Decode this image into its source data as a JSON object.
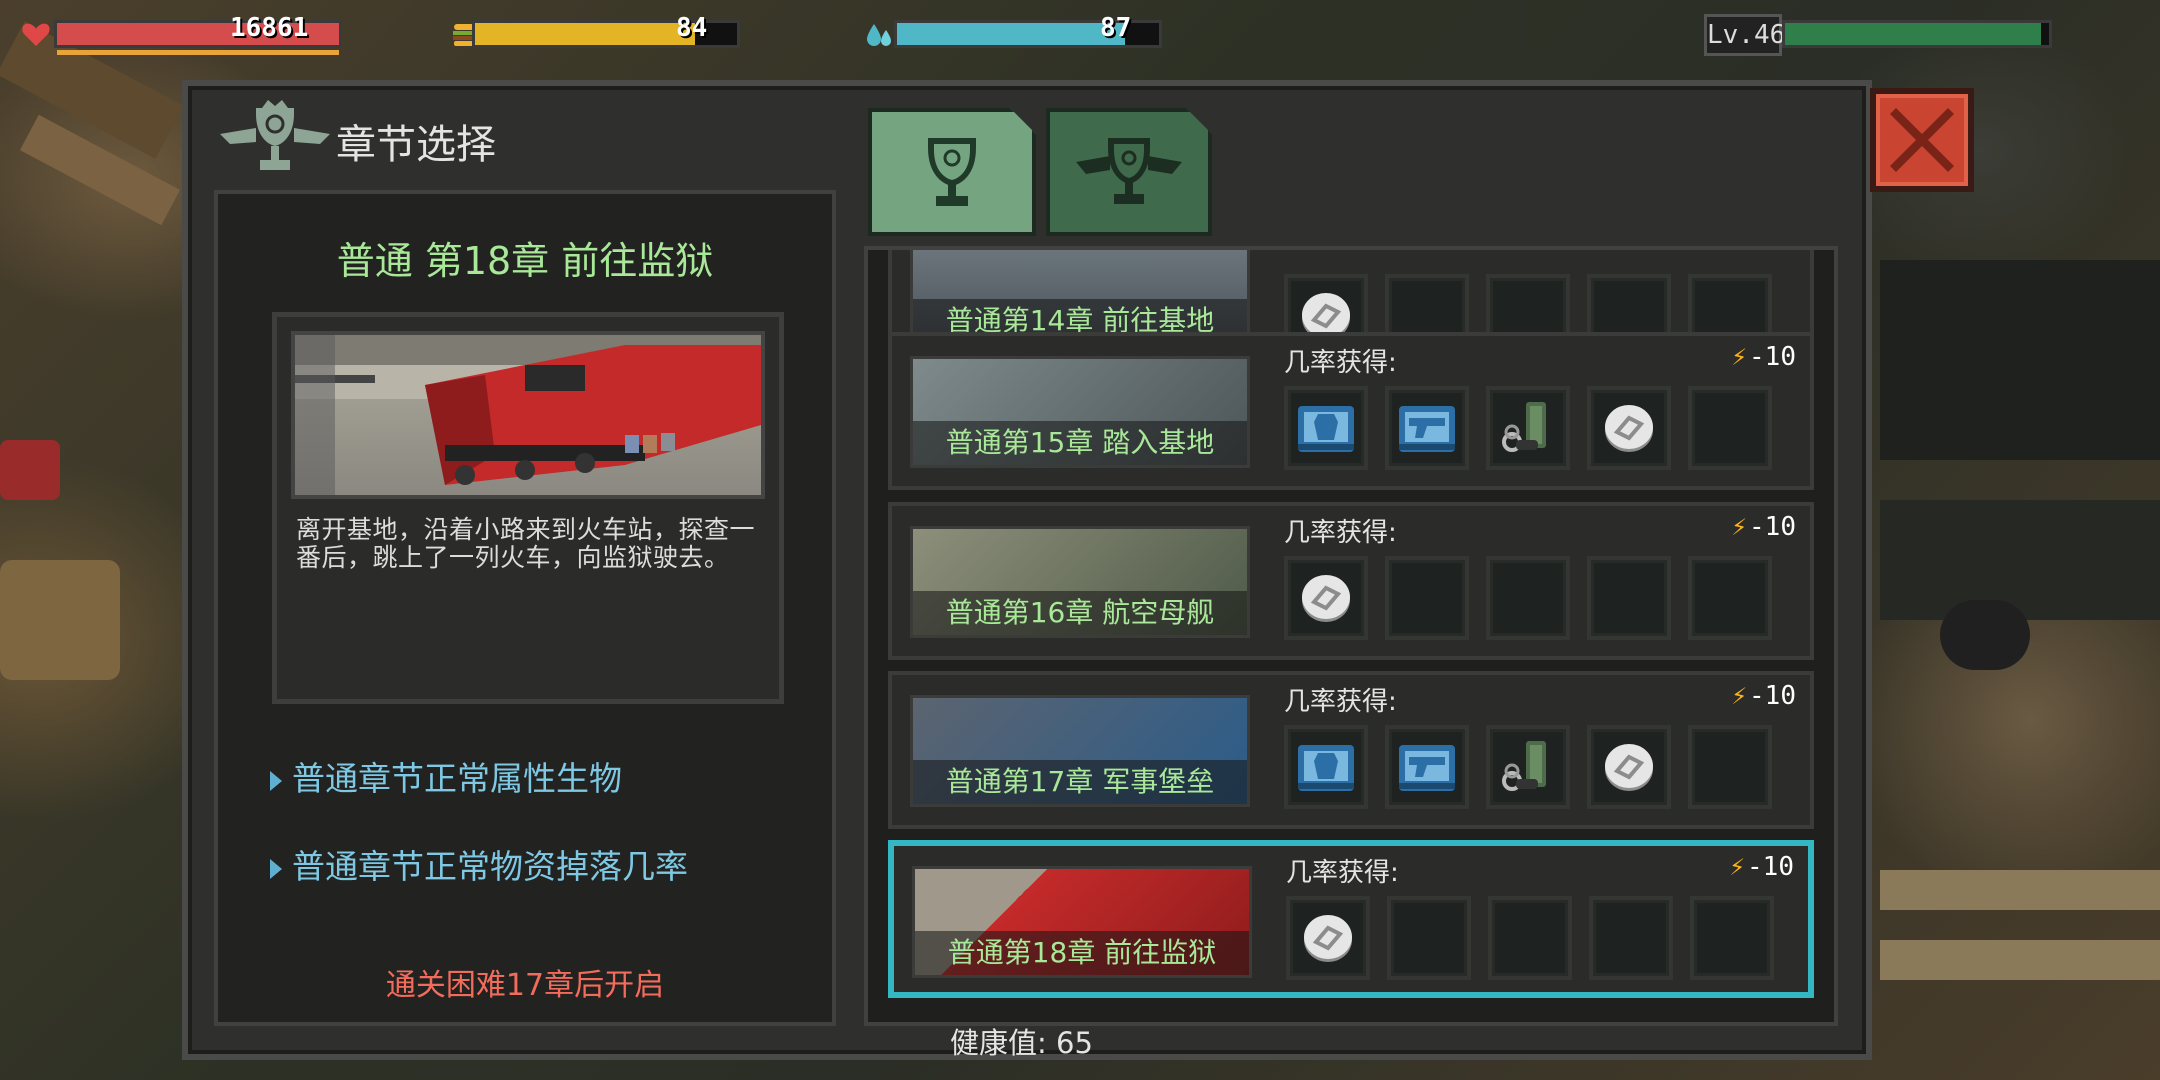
{
  "hud": {
    "hp": {
      "value": "16861",
      "fill": 1.0
    },
    "food": {
      "value": "84",
      "fill": 0.84
    },
    "water": {
      "value": "87",
      "fill": 0.87
    },
    "level": {
      "label": "Lv.46",
      "fill": 0.97
    }
  },
  "panel": {
    "title": "章节选择",
    "tabs": [
      {
        "name": "normal",
        "active": true
      },
      {
        "name": "hard",
        "active": false
      }
    ]
  },
  "detail": {
    "title": "普通 第18章 前往监狱",
    "description": "离开基地，沿着小路来到火车站，探查一番后，跳上了一列火车，向监狱驶去。",
    "links": [
      "普通章节正常属性生物",
      "普通章节正常物资掉落几率"
    ],
    "unlock_note": "通关困难17章后开启"
  },
  "chapters": [
    {
      "name": "普通第14章 前往基地",
      "chance_label": "",
      "cost": "",
      "items": [
        "coin-icon",
        "",
        "",
        "",
        ""
      ]
    },
    {
      "name": "普通第15章 踏入基地",
      "chance_label": "几率获得:",
      "cost": "-10",
      "items": [
        "armor-case-icon",
        "gun-case-icon",
        "ammo-icon",
        "coin-icon",
        ""
      ]
    },
    {
      "name": "普通第16章 航空母舰",
      "chance_label": "几率获得:",
      "cost": "-10",
      "items": [
        "coin-icon",
        "",
        "",
        "",
        ""
      ]
    },
    {
      "name": "普通第17章 军事堡垒",
      "chance_label": "几率获得:",
      "cost": "-10",
      "items": [
        "armor-case-icon",
        "gun-case-icon",
        "ammo-icon",
        "coin-icon",
        ""
      ]
    },
    {
      "name": "普通第18章 前往监狱",
      "chance_label": "几率获得:",
      "cost": "-10",
      "items": [
        "coin-icon",
        "",
        "",
        "",
        ""
      ],
      "selected": true
    }
  ],
  "health_label": "健康值: 65",
  "colors": {
    "accent_selected": "#33b7c2",
    "close": "#c94431",
    "title_green": "#a8e898",
    "warn": "#f26c5c"
  }
}
